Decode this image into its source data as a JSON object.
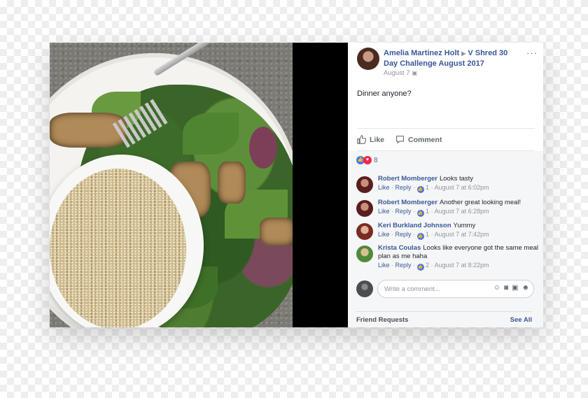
{
  "post": {
    "author": "Amelia Martinez Holt",
    "group": "V Shred 30 Day Challenge August 2017",
    "date": "August 7",
    "text": "Dinner anyone?",
    "more_label": "···"
  },
  "actions": {
    "like": "Like",
    "comment": "Comment"
  },
  "reactions": {
    "count": "8"
  },
  "comments": [
    {
      "name": "Robert Momberger",
      "text": "Looks tasty",
      "like": "Like",
      "reply": "Reply",
      "likes": "1",
      "time": "August 7 at 6:02pm"
    },
    {
      "name": "Robert Momberger",
      "text": "Another great looking meal!",
      "like": "Like",
      "reply": "Reply",
      "likes": "1",
      "time": "August 7 at 6:28pm"
    },
    {
      "name": "Keri Burkland Johnson",
      "text": "Yummy",
      "like": "Like",
      "reply": "Reply",
      "likes": "1",
      "time": "August 7 at 7:42pm"
    },
    {
      "name": "Krista Coulas",
      "text": "Looks like everyone got the same meal plan as me haha",
      "like": "Like",
      "reply": "Reply",
      "likes": "2",
      "time": "August 7 at 8:22pm"
    }
  ],
  "composer": {
    "placeholder": "Write a comment..."
  },
  "friend_requests": {
    "title": "Friend Requests",
    "see_all": "See All"
  },
  "colors": {
    "link": "#385898",
    "meta": "#90949c",
    "like_blue": "#4a76e8",
    "love_red": "#f0284a"
  }
}
